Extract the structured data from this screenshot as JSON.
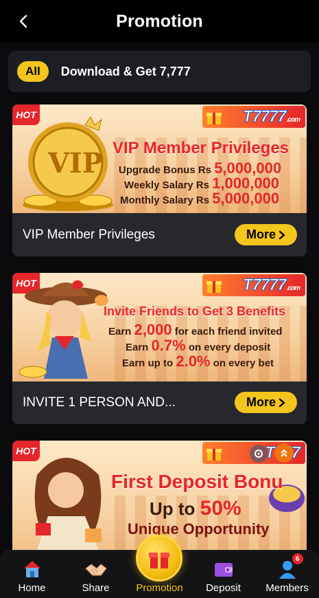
{
  "header": {
    "title": "Promotion"
  },
  "filter": {
    "chip": "All",
    "text": "Download & Get 7,777"
  },
  "cards": [
    {
      "label": "VIP Member Privileges",
      "more": "More",
      "banner": {
        "brand": "T7777",
        "brand_suffix": ".com",
        "hot": "HOT",
        "emblem": "VIP",
        "title": "VIP Member Privileges",
        "lines": [
          {
            "text": "Upgrade Bonus Rs",
            "value": "5,000,000"
          },
          {
            "text": "Weekly Salary Rs",
            "value": "1,000,000"
          },
          {
            "text": "Monthly Salary Rs",
            "value": "5,000,000"
          }
        ]
      }
    },
    {
      "label": "INVITE 1 PERSON AND...",
      "more": "More",
      "banner": {
        "brand": "T7777",
        "brand_suffix": ".com",
        "hot": "HOT",
        "title": "Invite Friends to Get 3 Benefits",
        "lines": [
          {
            "pre": "Earn",
            "value": "2,000",
            "post": "for each friend invited"
          },
          {
            "pre": "Earn",
            "value": "0.7%",
            "post": "on every deposit"
          },
          {
            "pre": "Earn up to",
            "value": "2.0%",
            "post": "on every bet"
          }
        ]
      }
    },
    {
      "banner": {
        "brand": "T777",
        "hot": "HOT",
        "title": "First Deposit Bonu",
        "line1_pre": "Up to",
        "line1_value": "50%",
        "line2": "Unique Opportunity"
      }
    }
  ],
  "nav": {
    "items": [
      {
        "label": "Home",
        "icon": "home-icon"
      },
      {
        "label": "Share",
        "icon": "handshake-icon"
      },
      {
        "label": "Promotion",
        "icon": "gift-icon",
        "active": true
      },
      {
        "label": "Deposit",
        "icon": "wallet-icon"
      },
      {
        "label": "Members",
        "icon": "user-icon",
        "badge": "6"
      }
    ]
  },
  "colors": {
    "accent": "#f4c51c",
    "background": "#0b0b0d",
    "card": "#27282e",
    "hot": "#e5262b"
  }
}
